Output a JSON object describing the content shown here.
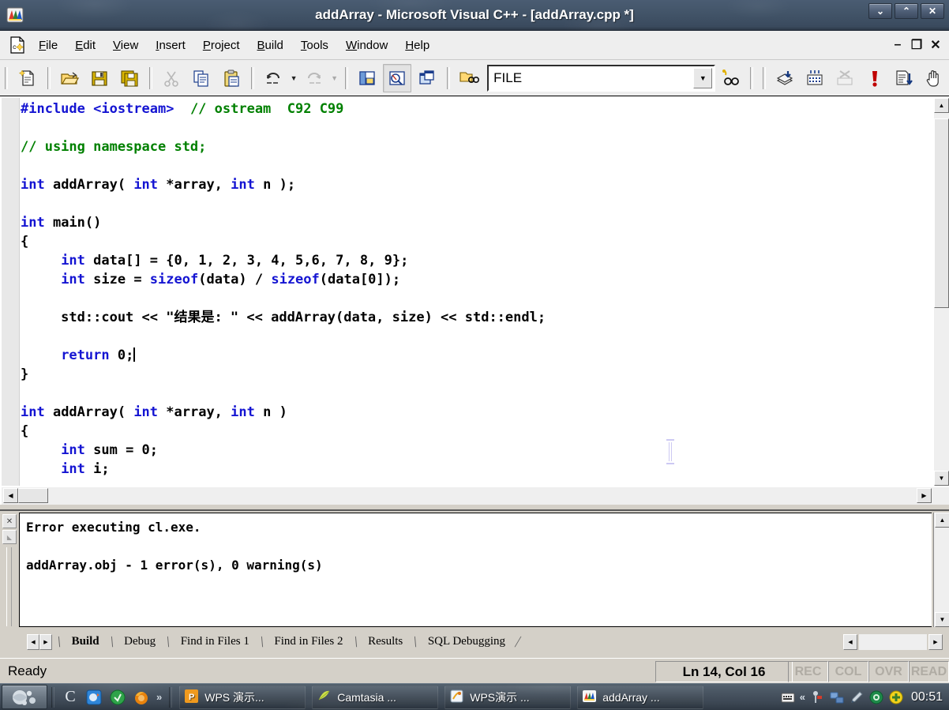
{
  "window": {
    "title": "addArray - Microsoft Visual C++ - [addArray.cpp *]",
    "app_icon": "vc-app-icon",
    "controls": [
      {
        "name": "minimize-window-button",
        "glyph": "⌄"
      },
      {
        "name": "maximize-window-button",
        "glyph": "⌃"
      },
      {
        "name": "close-window-button",
        "glyph": "✕"
      }
    ]
  },
  "menubar": {
    "document_icon": "cpp-document-icon",
    "items": [
      {
        "label": "File",
        "accel": "F"
      },
      {
        "label": "Edit",
        "accel": "E"
      },
      {
        "label": "View",
        "accel": "V"
      },
      {
        "label": "Insert",
        "accel": "I"
      },
      {
        "label": "Project",
        "accel": "P"
      },
      {
        "label": "Build",
        "accel": "B"
      },
      {
        "label": "Tools",
        "accel": "T"
      },
      {
        "label": "Window",
        "accel": "W"
      },
      {
        "label": "Help",
        "accel": "H"
      }
    ],
    "mdi_controls": [
      {
        "name": "mdi-minimize-button",
        "glyph": "–"
      },
      {
        "name": "mdi-restore-button",
        "glyph": "❐"
      },
      {
        "name": "mdi-close-button",
        "glyph": "✕"
      }
    ]
  },
  "toolbar": {
    "buttons": [
      {
        "name": "new-text-file-icon",
        "tip": "New Text File"
      },
      {
        "name": "open-folder-icon",
        "tip": "Open"
      },
      {
        "name": "save-icon",
        "tip": "Save"
      },
      {
        "name": "save-all-icon",
        "tip": "Save All"
      },
      {
        "name": "cut-scissors-icon",
        "tip": "Cut",
        "disabled": true
      },
      {
        "name": "copy-icon",
        "tip": "Copy"
      },
      {
        "name": "paste-clipboard-icon",
        "tip": "Paste"
      },
      {
        "name": "undo-icon",
        "tip": "Undo"
      },
      {
        "name": "redo-icon",
        "tip": "Redo",
        "disabled": true
      },
      {
        "name": "workspace-window-icon",
        "tip": "Workspace"
      },
      {
        "name": "output-window-icon",
        "tip": "Output",
        "pressed": true
      },
      {
        "name": "window-list-icon",
        "tip": "Windows"
      },
      {
        "name": "find-in-files-icon",
        "tip": "Find in Files"
      },
      {
        "name": "find-binoculars-icon",
        "tip": "Find"
      },
      {
        "name": "compile-icon",
        "tip": "Compile"
      },
      {
        "name": "build-icon",
        "tip": "Build"
      },
      {
        "name": "stop-build-icon",
        "tip": "Stop Build",
        "disabled": true
      },
      {
        "name": "execute-program-icon",
        "tip": "Execute Program"
      },
      {
        "name": "go-debug-icon",
        "tip": "Go"
      },
      {
        "name": "insert-breakpoint-hand-icon",
        "tip": "Insert/Remove Breakpoint"
      }
    ],
    "search_combo": {
      "value": "FILE",
      "placeholder": "",
      "arrow": "▼"
    }
  },
  "editor": {
    "lines": [
      [
        {
          "t": "#include <iostream>  ",
          "c": "kw"
        },
        {
          "t": "// ostream  C92 C99",
          "c": "cm"
        }
      ],
      [],
      [
        {
          "t": "// using namespace std;",
          "c": "cm"
        }
      ],
      [],
      [
        {
          "t": "int",
          "c": "kw"
        },
        {
          "t": " addArray( ",
          "c": ""
        },
        {
          "t": "int",
          "c": "kw"
        },
        {
          "t": " *array, ",
          "c": ""
        },
        {
          "t": "int",
          "c": "kw"
        },
        {
          "t": " n );",
          "c": ""
        }
      ],
      [],
      [
        {
          "t": "int",
          "c": "kw"
        },
        {
          "t": " main()",
          "c": ""
        }
      ],
      [
        {
          "t": "{",
          "c": ""
        }
      ],
      [
        {
          "t": "     ",
          "c": ""
        },
        {
          "t": "int",
          "c": "kw"
        },
        {
          "t": " data[] = {0, 1, 2, 3, 4, 5,6, 7, 8, 9};",
          "c": ""
        }
      ],
      [
        {
          "t": "     ",
          "c": ""
        },
        {
          "t": "int",
          "c": "kw"
        },
        {
          "t": " size = ",
          "c": ""
        },
        {
          "t": "sizeof",
          "c": "kw"
        },
        {
          "t": "(data) / ",
          "c": ""
        },
        {
          "t": "sizeof",
          "c": "kw"
        },
        {
          "t": "(data[0]);",
          "c": ""
        }
      ],
      [],
      [
        {
          "t": "     std::cout << \"结果是: \" << addArray(data, size) << std::endl;",
          "c": ""
        }
      ],
      [],
      [
        {
          "t": "     ",
          "c": ""
        },
        {
          "t": "return",
          "c": "kw"
        },
        {
          "t": " 0;",
          "c": ""
        },
        {
          "t": "|CARET|",
          "c": "caret"
        }
      ],
      [
        {
          "t": "}",
          "c": ""
        }
      ],
      [],
      [
        {
          "t": "int",
          "c": "kw"
        },
        {
          "t": " addArray( ",
          "c": ""
        },
        {
          "t": "int",
          "c": "kw"
        },
        {
          "t": " *array, ",
          "c": ""
        },
        {
          "t": "int",
          "c": "kw"
        },
        {
          "t": " n )",
          "c": ""
        }
      ],
      [
        {
          "t": "{",
          "c": ""
        }
      ],
      [
        {
          "t": "     ",
          "c": ""
        },
        {
          "t": "int",
          "c": "kw"
        },
        {
          "t": " sum = 0;",
          "c": ""
        }
      ],
      [
        {
          "t": "     ",
          "c": ""
        },
        {
          "t": "int",
          "c": "kw"
        },
        {
          "t": " i;",
          "c": ""
        }
      ]
    ],
    "colors": {
      "keyword": "#1414d2",
      "comment": "#008000",
      "text": "#000000",
      "background": "#ffffff"
    },
    "cursor_shape": "text-ibeam-cursor"
  },
  "output": {
    "lines": [
      "Error executing cl.exe.",
      "",
      "addArray.obj - 1 error(s), 0 warning(s)"
    ],
    "close_glyph": "✕",
    "scroll_up_glyph": "▲",
    "scroll_down_glyph": "▼"
  },
  "output_tabs": {
    "nav_left": "◀",
    "nav_right": "▶",
    "items": [
      {
        "label": "Build",
        "active": true
      },
      {
        "label": "Debug",
        "active": false
      },
      {
        "label": "Find in Files 1",
        "active": false
      },
      {
        "label": "Find in Files 2",
        "active": false
      },
      {
        "label": "Results",
        "active": false
      },
      {
        "label": "SQL Debugging",
        "active": false
      }
    ]
  },
  "statusbar": {
    "message": "Ready",
    "position": "Ln 14, Col 16",
    "flags": [
      "REC",
      "COL",
      "OVR",
      "READ"
    ]
  },
  "taskbar": {
    "start_label": "",
    "start_icon": "start-orb-icon",
    "quick_launch": [
      {
        "name": "chrome-c-icon",
        "glyph": "C"
      },
      {
        "name": "blue-app-icon",
        "glyph": ""
      },
      {
        "name": "green-circle-icon",
        "glyph": ""
      },
      {
        "name": "firefox-icon",
        "glyph": ""
      },
      {
        "name": "quicklaunch-overflow-chevron",
        "glyph": "»"
      }
    ],
    "tasks": [
      {
        "label": "WPS 演示...",
        "icon": "wps-presentation-icon"
      },
      {
        "label": "Camtasia ...",
        "icon": "camtasia-icon"
      },
      {
        "label": "WPS演示 ...",
        "icon": "wps-doc-icon"
      },
      {
        "label": "addArray ...",
        "icon": "visual-cpp-icon"
      }
    ],
    "tray": {
      "overflow_chevron": "«",
      "icons": [
        {
          "name": "keyboard-ime-icon"
        },
        {
          "name": "pin-tray-icon"
        },
        {
          "name": "network-icon"
        },
        {
          "name": "pen-tray-icon"
        },
        {
          "name": "green-shield-icon"
        },
        {
          "name": "yellow-plus-icon"
        }
      ],
      "clock": "00:51"
    }
  }
}
